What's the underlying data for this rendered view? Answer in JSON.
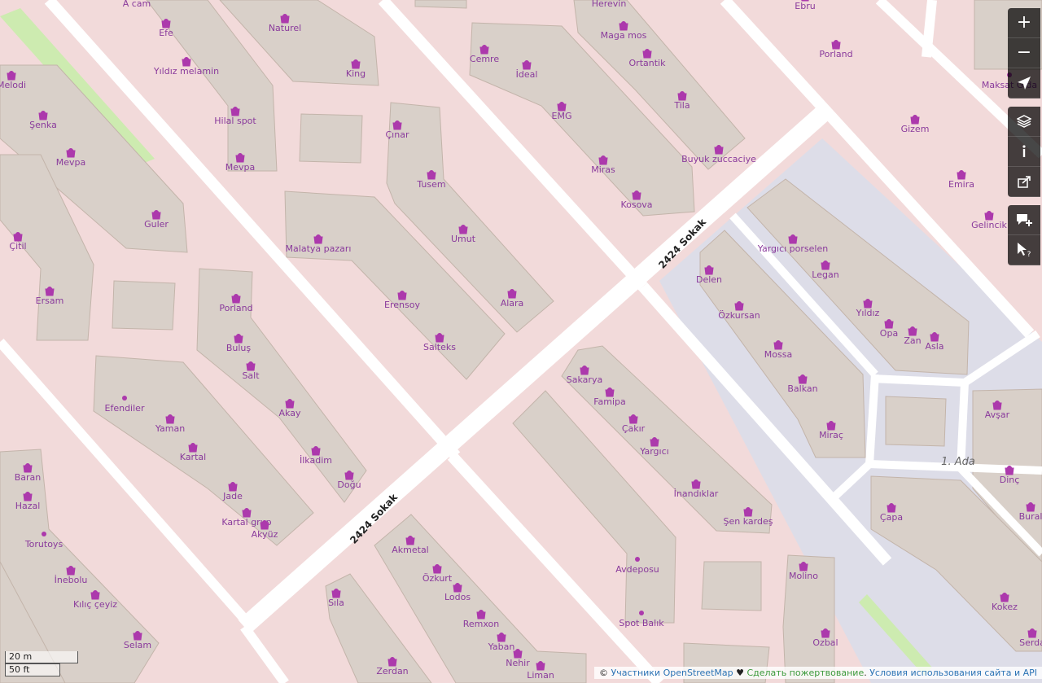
{
  "streets": [
    "2424 Sokak",
    "2424 Sokak"
  ],
  "area_label": "1. Ada",
  "shops": [
    "A cam",
    "Efe",
    "Yıldız melamin",
    "Naturel",
    "King",
    "Hilal spot",
    "Mevpa",
    "Melodi",
    "Şenka",
    "Mevpa",
    "Guler",
    "Çitil",
    "Ersam",
    "Herevin",
    "Maga mos",
    "Ortantik",
    "Tila",
    "Buyuk zuccaciye",
    "Cemre",
    "İdeal",
    "EMG",
    "Miras",
    "Kosova",
    "Ebru",
    "Porland",
    "Maksat Gida",
    "Gizem",
    "Emira",
    "Gelincik",
    "Çınar",
    "Tusem",
    "Umut",
    "Alara",
    "Malatya pazarı",
    "Erensoy",
    "Salteks",
    "Porland",
    "Buluş",
    "Salt",
    "Akay",
    "İlkadim",
    "Doğu",
    "Efendiler",
    "Yaman",
    "Kartal",
    "Jade",
    "Kartal grup",
    "Akyüz",
    "Baran",
    "Hazal",
    "Torutoys",
    "İnebolu",
    "Kılıç çeyiz",
    "Selam",
    "Yargıcı porselen",
    "Legan",
    "Yıldız",
    "Opa",
    "Zan",
    "Asla",
    "Delen",
    "Özkursan",
    "Mossa",
    "Balkan",
    "Miraç",
    "Avşar",
    "Dinç",
    "Bural",
    "Çapa",
    "Kokez",
    "Serda",
    "Sakarya",
    "Famipa",
    "Çakır",
    "Yargıcı",
    "İnandıklar",
    "Şen kardeş",
    "Akmetal",
    "Özkurt",
    "Lodos",
    "Remxon",
    "Yaban",
    "Nehir",
    "Liman",
    "Sıla",
    "Zerdan",
    "Avdeposu",
    "Spot Balık",
    "Molino",
    "Ozbal"
  ],
  "controls": {
    "zoom_in": "+",
    "zoom_out": "−"
  },
  "scale": {
    "metric": "20 m",
    "imperial": "50 ft"
  },
  "attribution": {
    "prefix": "©",
    "osm": "Участники OpenStreetMap",
    "heart": "♥",
    "donate": "Сделать пожертвование",
    "terms": "Условия использования сайта и API"
  },
  "colors": {
    "background": "#f2dada",
    "building": "#d9d0c9",
    "road": "#ffffff",
    "shop_icon": "#ac39ac",
    "plaza": "#dddde8",
    "green": "#cdebb0"
  }
}
